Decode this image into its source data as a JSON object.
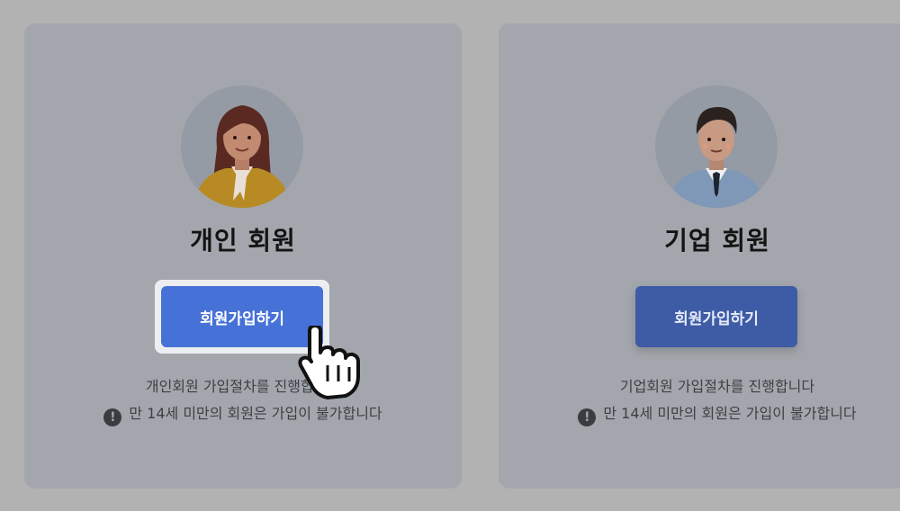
{
  "cards": [
    {
      "id": "individual",
      "title": "개인 회원",
      "button_label": "회원가입하기",
      "description": "개인회원 가입절차를 진행합니다",
      "notice": "만 14세 미만의 회원은 가입이 불가합니다",
      "avatar": "woman-avatar-icon",
      "state": "hovered"
    },
    {
      "id": "business",
      "title": "기업 회원",
      "button_label": "회원가입하기",
      "description": "기업회원 가입절차를 진행합니다",
      "notice": "만 14세 미만의 회원은 가입이 불가합니다",
      "avatar": "man-avatar-icon",
      "state": "default"
    }
  ],
  "icons": {
    "warning": "exclamation-circle-icon",
    "cursor": "hand-pointer-icon"
  },
  "colors": {
    "active_button": "#4671d6",
    "dim_button": "#3e5ca6",
    "overlay": "#b2b2b3"
  }
}
